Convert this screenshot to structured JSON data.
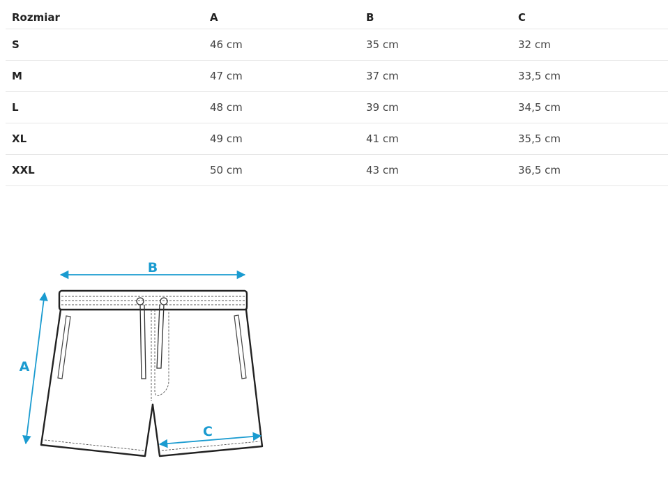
{
  "size_table": {
    "headers": [
      "Rozmiar",
      "A",
      "B",
      "C"
    ],
    "rows": [
      {
        "size": "S",
        "a": "46 cm",
        "b": "35 cm",
        "c": "32 cm"
      },
      {
        "size": "M",
        "a": "47 cm",
        "b": "37 cm",
        "c": "33,5 cm"
      },
      {
        "size": "L",
        "a": "48 cm",
        "b": "39 cm",
        "c": "34,5 cm"
      },
      {
        "size": "XL",
        "a": "49 cm",
        "b": "41 cm",
        "c": "35,5 cm"
      },
      {
        "size": "XXL",
        "a": "50 cm",
        "b": "43 cm",
        "c": "36,5 cm"
      }
    ]
  },
  "diagram": {
    "label_a": "A",
    "label_b": "B",
    "label_c": "C",
    "accent_color": "#1a9bd0",
    "outline_color": "#222222"
  }
}
